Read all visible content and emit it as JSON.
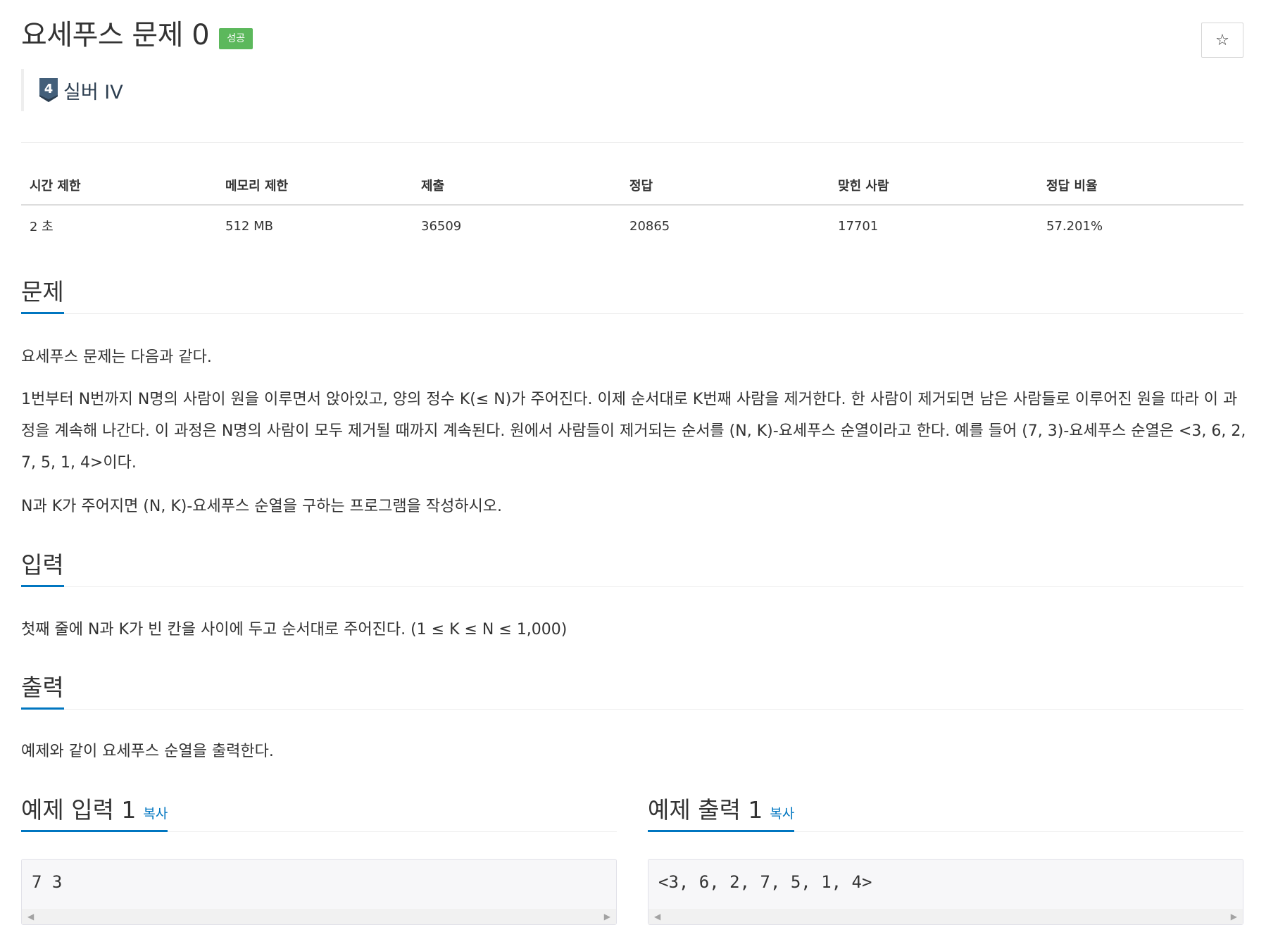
{
  "header": {
    "title": "요세푸스 문제 0",
    "status_badge": "성공",
    "star_label": "☆",
    "tier": {
      "level": "4",
      "label": "실버 IV",
      "color": "#435f7a"
    }
  },
  "stats": {
    "columns": [
      "시간 제한",
      "메모리 제한",
      "제출",
      "정답",
      "맞힌 사람",
      "정답 비율"
    ],
    "values": [
      "2 초",
      "512 MB",
      "36509",
      "20865",
      "17701",
      "57.201%"
    ]
  },
  "problem": {
    "heading": "문제",
    "paragraphs": [
      "요세푸스 문제는 다음과 같다.",
      "1번부터 N번까지 N명의 사람이 원을 이루면서 앉아있고, 양의 정수 K(≤ N)가 주어진다. 이제 순서대로 K번째 사람을 제거한다. 한 사람이 제거되면 남은 사람들로 이루어진 원을 따라 이 과정을 계속해 나간다. 이 과정은 N명의 사람이 모두 제거될 때까지 계속된다. 원에서 사람들이 제거되는 순서를 (N, K)-요세푸스 순열이라고 한다. 예를 들어 (7, 3)-요세푸스 순열은 <3, 6, 2, 7, 5, 1, 4>이다.",
      "N과 K가 주어지면 (N, K)-요세푸스 순열을 구하는 프로그램을 작성하시오."
    ]
  },
  "input": {
    "heading": "입력",
    "text": "첫째 줄에 N과 K가 빈 칸을 사이에 두고 순서대로 주어진다. (1 ≤ K ≤ N ≤ 1,000)"
  },
  "output": {
    "heading": "출력",
    "text": "예제와 같이 요세푸스 순열을 출력한다."
  },
  "samples": {
    "input": {
      "heading": "예제 입력 1",
      "copy_label": "복사",
      "content": "7 3"
    },
    "output": {
      "heading": "예제 출력 1",
      "copy_label": "복사",
      "content": "<3, 6, 2, 7, 5, 1, 4>"
    }
  },
  "colors": {
    "accent": "#0076c0",
    "success": "#5cb85c"
  }
}
